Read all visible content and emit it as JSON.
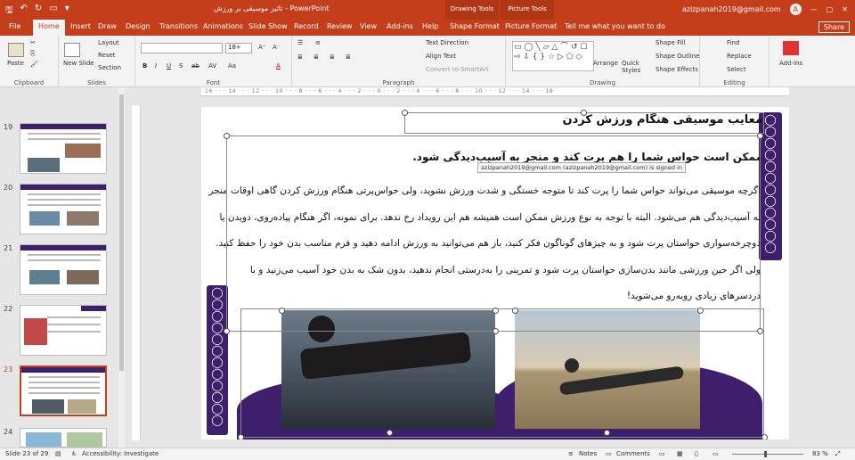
{
  "titlebar": {
    "doc_title": "تاثیر موسیقی بر ورزش  -  PowerPoint",
    "context_drawing": "Drawing Tools",
    "context_picture": "Picture Tools",
    "user_email": "azizpanah2019@gmail.com",
    "avatar_letter": "A",
    "minimize": "—",
    "restore": "▢",
    "close": "✕"
  },
  "qat": {
    "save": "🖫",
    "undo": "↶",
    "redo": "↻",
    "present": "▭",
    "more": "▾"
  },
  "tabs": [
    "File",
    "Home",
    "Insert",
    "Draw",
    "Design",
    "Transitions",
    "Animations",
    "Slide Show",
    "Record",
    "Review",
    "View",
    "Add-ins",
    "Help",
    "Shape Format",
    "Picture Format"
  ],
  "active_tab": "Home",
  "tell_me": "Tell me what you want to do",
  "share": "Share",
  "ribbon": {
    "clipboard": {
      "label": "Clipboard",
      "paste": "Paste"
    },
    "slides": {
      "label": "Slides",
      "new_slide": "New Slide",
      "layout": "Layout",
      "reset": "Reset",
      "section": "Section"
    },
    "font": {
      "label": "Font",
      "size": "18+",
      "bold": "B",
      "italic": "I",
      "underline": "U",
      "strike": "S",
      "abc": "ab",
      "av": "AV",
      "aa": "Aa",
      "color": "A"
    },
    "paragraph": {
      "label": "Paragraph",
      "text_direction": "Text Direction",
      "align_text": "Align Text",
      "smartart": "Convert to SmartArt"
    },
    "drawing": {
      "label": "Drawing",
      "arrange": "Arrange",
      "quick_styles": "Quick Styles",
      "shape_fill": "Shape Fill",
      "shape_outline": "Shape Outline",
      "shape_effects": "Shape Effects",
      "shapes_glyphs": "▭ ◯ ╲ ▱ △ ⌒ ↺ ☐ ⇨ ⇩ { } ☆ ▷ ⬠ ◇"
    },
    "editing": {
      "label": "Editing",
      "find": "Find",
      "replace": "Replace",
      "select": "Select"
    },
    "addins": {
      "label": "Add-ins"
    }
  },
  "thumbnails": [
    {
      "num": "19",
      "selected": false
    },
    {
      "num": "20",
      "selected": false
    },
    {
      "num": "21",
      "selected": false
    },
    {
      "num": "22",
      "selected": false
    },
    {
      "num": "23",
      "selected": true
    },
    {
      "num": "24",
      "selected": false
    }
  ],
  "ruler_numbers": "16 · · · 14 · · · 12 · · · 10 · · · 8 · · · 6 · · · 4 · · · 2 · · · 0 · · · 2 · · · 4 · · · 6 · · · 8 · · · 10 · · · 12 · · · 14 · · · 16",
  "slide": {
    "title": "معایب موسیقی هنگام ورزش کردن",
    "subtitle": "ممکن است حواس شما را هم پرت کند و منجر به آسیب‌دیدگی شود.",
    "body": "اگرچه موسیقی می‌تواند حواس شما را پرت کند تا متوجه خستگی و شدت ورزش نشوید، ولی حواس‌پرتی هنگام ورزش کردن گاهی اوقات منجر به آسیب‌دیدگی هم می‌شود. البته با توجه به نوع ورزش ممکن است همیشه هم این رویداد رخ ندهد. برای نمونه، اگر هنگام پیاده‌روی، دویدن یا دوچرخه‌سواری حواستان پرت شود و به چیزهای گوناگون فکر کنید، باز هم می‌توانید به ورزش ادامه دهید و فرم مناسب بدن خود را حفظ کنید. ولی اگر حین ورزشی مانند بدن‌سازی حواستان پرت شود و تمرینی را به‌درستی انجام ندهید، بدون شک به بدن خود آسیب می‌زنید و با دردسرهای زیادی روبه‌رو می‌شوید!",
    "tooltip": "azizpanah2019@gmail.com (azizpanah2019@gmail.com) is signed in"
  },
  "status": {
    "slide_info": "Slide 23 of 29",
    "accessibility": "Accessibility: Investigate",
    "notes": "Notes",
    "comments": "Comments",
    "zoom": "83 %"
  },
  "colors": {
    "accent": "#c43e1c",
    "slide_purple": "#3d1f6b"
  }
}
